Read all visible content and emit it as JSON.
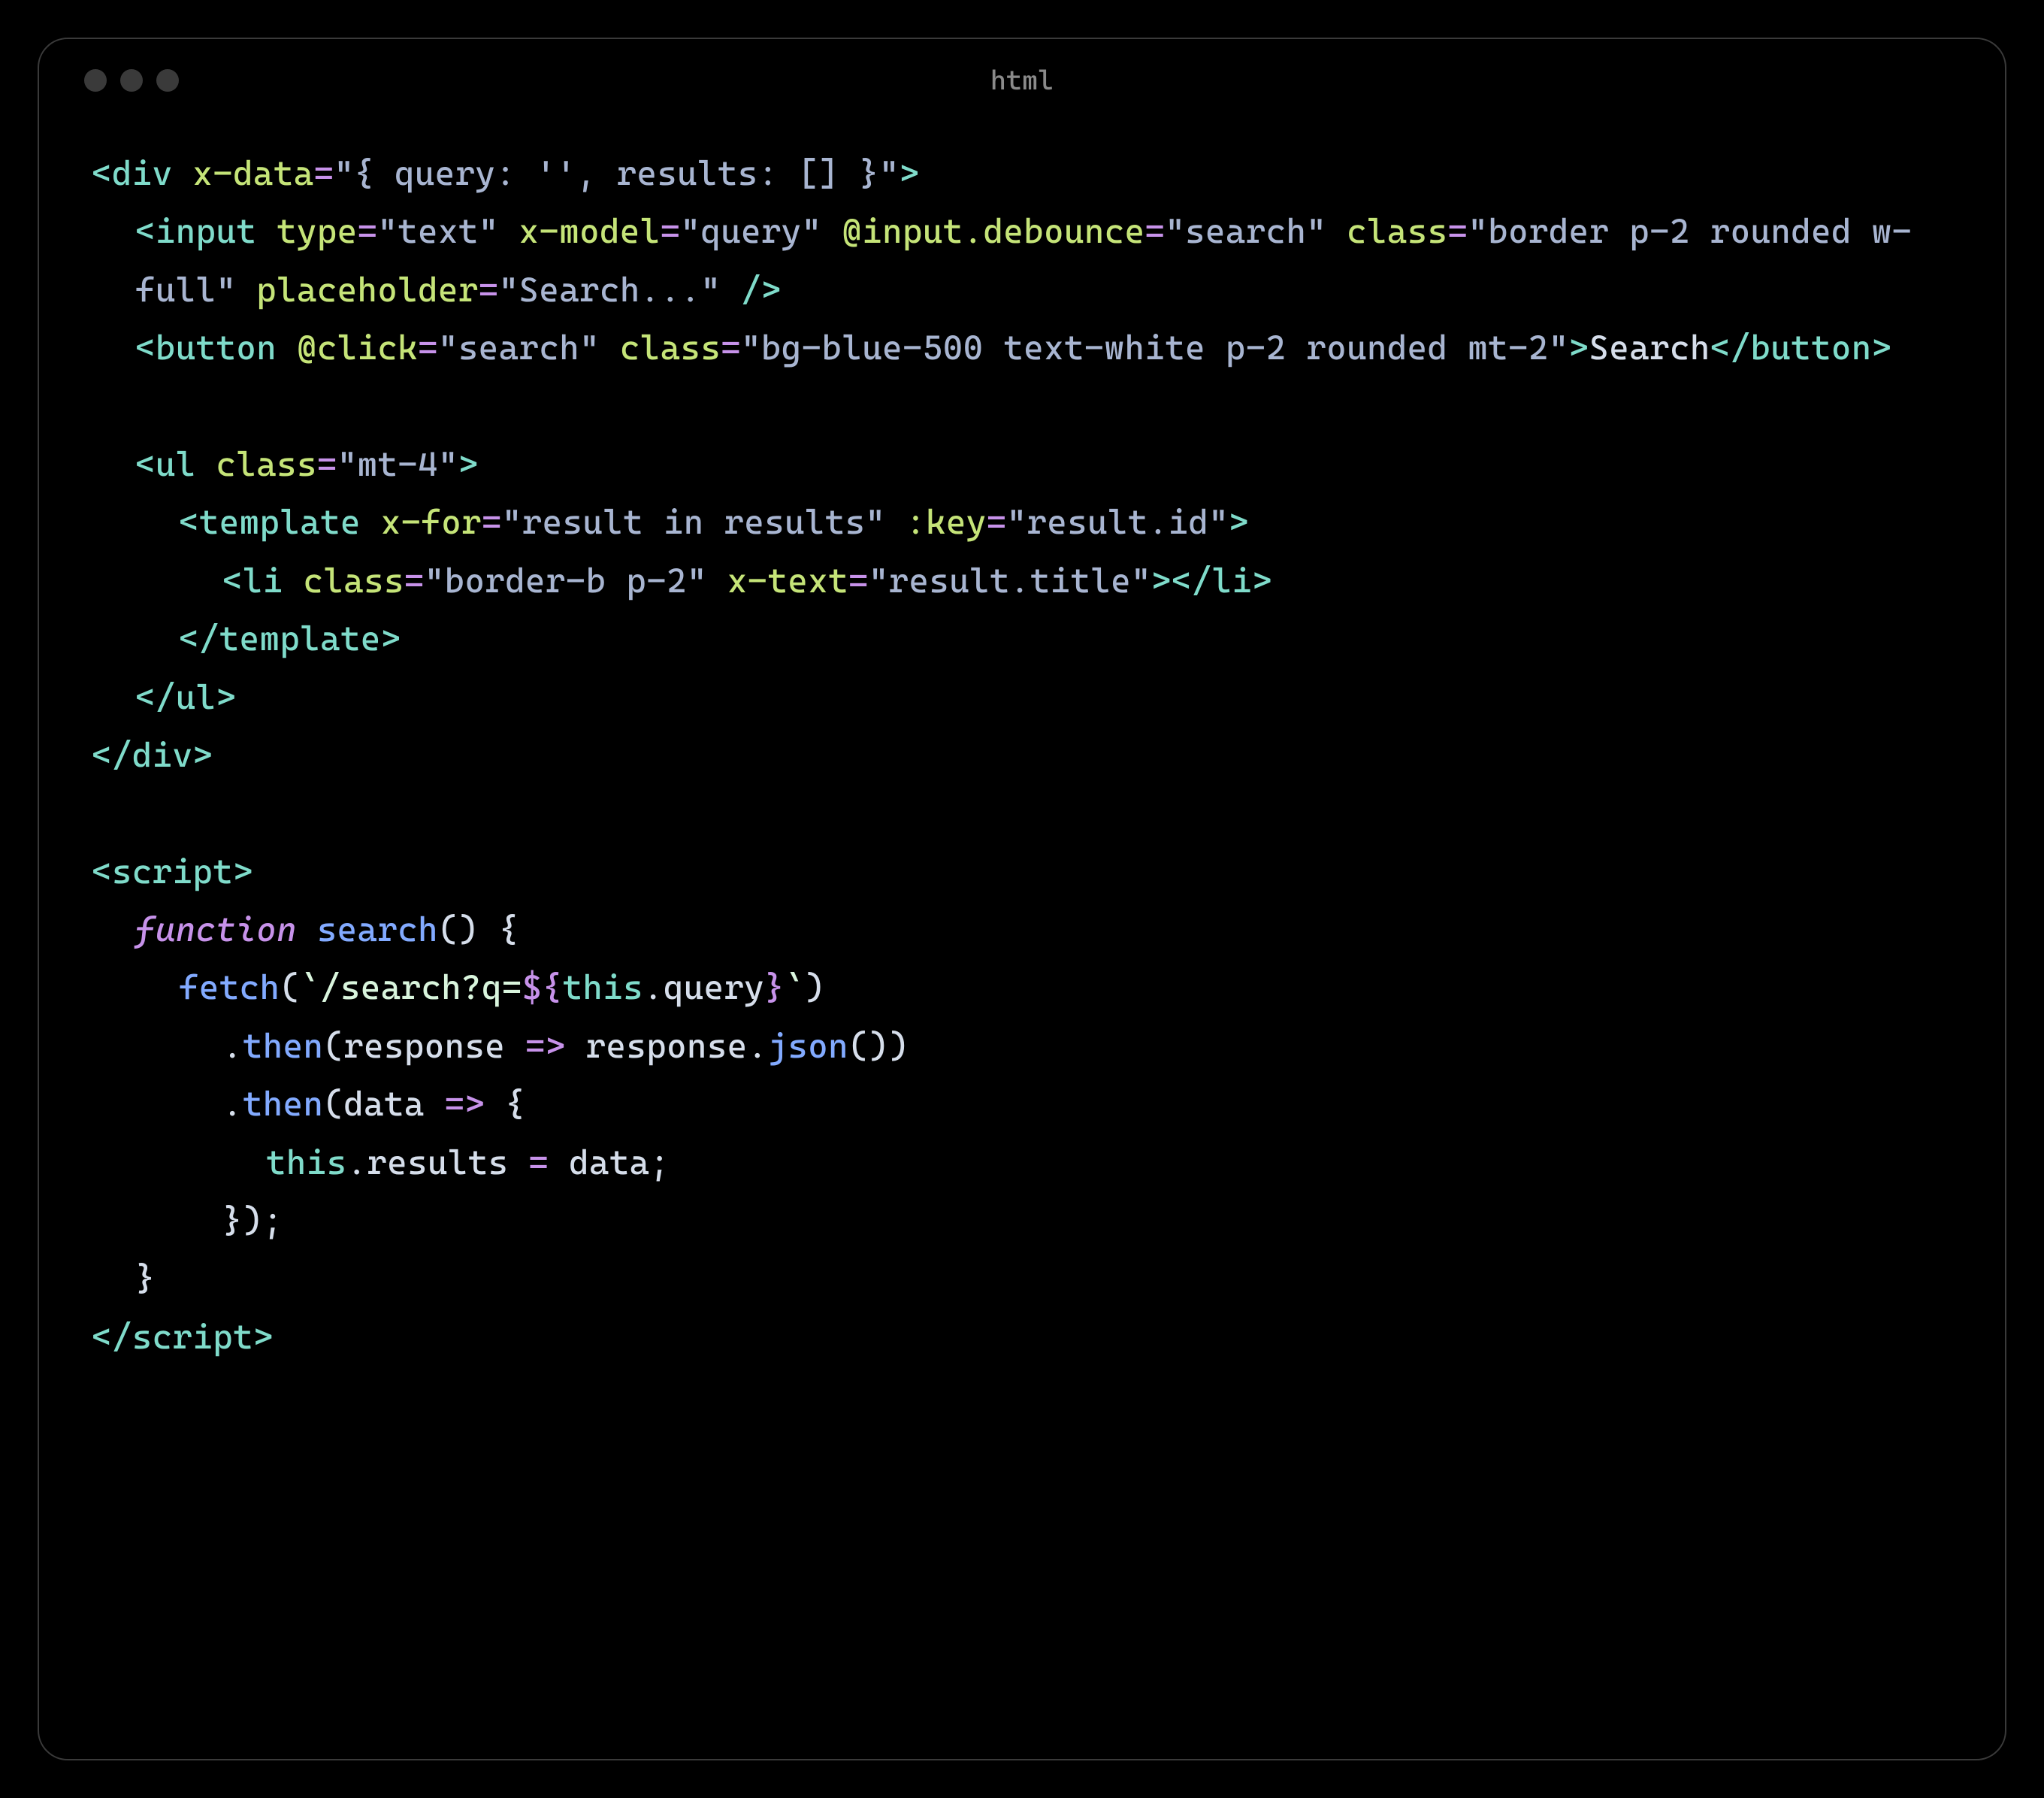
{
  "window": {
    "title": "html"
  },
  "code": {
    "lines": [
      {
        "indent": 0,
        "segs": [
          {
            "c": "punct",
            "t": "<"
          },
          {
            "c": "tag",
            "t": "div"
          },
          {
            "c": "txt",
            "t": " "
          },
          {
            "c": "attr",
            "t": "x-data"
          },
          {
            "c": "eq",
            "t": "="
          },
          {
            "c": "str",
            "t": "\"{ query: '', results: [] }\""
          },
          {
            "c": "punct",
            "t": ">"
          }
        ]
      },
      {
        "indent": 1,
        "segs": [
          {
            "c": "punct",
            "t": "<"
          },
          {
            "c": "tag",
            "t": "input"
          },
          {
            "c": "txt",
            "t": " "
          },
          {
            "c": "attr",
            "t": "type"
          },
          {
            "c": "eq",
            "t": "="
          },
          {
            "c": "str",
            "t": "\"text\""
          },
          {
            "c": "txt",
            "t": " "
          },
          {
            "c": "attr",
            "t": "x-model"
          },
          {
            "c": "eq",
            "t": "="
          },
          {
            "c": "str",
            "t": "\"query\""
          },
          {
            "c": "txt",
            "t": " "
          },
          {
            "c": "attr",
            "t": "@input.debounce"
          },
          {
            "c": "eq",
            "t": "="
          },
          {
            "c": "str",
            "t": "\"search\""
          },
          {
            "c": "txt",
            "t": " "
          },
          {
            "c": "attr",
            "t": "class"
          },
          {
            "c": "eq",
            "t": "="
          },
          {
            "c": "str",
            "t": "\"border p-2 rounded w-full\""
          },
          {
            "c": "txt",
            "t": " "
          },
          {
            "c": "attr",
            "t": "placeholder"
          },
          {
            "c": "eq",
            "t": "="
          },
          {
            "c": "str",
            "t": "\"Search...\""
          },
          {
            "c": "txt",
            "t": " "
          },
          {
            "c": "punct",
            "t": "/>"
          }
        ]
      },
      {
        "indent": 1,
        "segs": [
          {
            "c": "punct",
            "t": "<"
          },
          {
            "c": "tag",
            "t": "button"
          },
          {
            "c": "txt",
            "t": " "
          },
          {
            "c": "attr",
            "t": "@click"
          },
          {
            "c": "eq",
            "t": "="
          },
          {
            "c": "str",
            "t": "\"search\""
          },
          {
            "c": "txt",
            "t": " "
          },
          {
            "c": "attr",
            "t": "class"
          },
          {
            "c": "eq",
            "t": "="
          },
          {
            "c": "str",
            "t": "\"bg-blue-500 text-white p-2 rounded mt-2\""
          },
          {
            "c": "punct",
            "t": ">"
          },
          {
            "c": "txt",
            "t": "Search"
          },
          {
            "c": "punct",
            "t": "</"
          },
          {
            "c": "tag",
            "t": "button"
          },
          {
            "c": "punct",
            "t": ">"
          }
        ]
      },
      {
        "indent": 0,
        "segs": [
          {
            "c": "txt",
            "t": " "
          }
        ]
      },
      {
        "indent": 1,
        "segs": [
          {
            "c": "punct",
            "t": "<"
          },
          {
            "c": "tag",
            "t": "ul"
          },
          {
            "c": "txt",
            "t": " "
          },
          {
            "c": "attr",
            "t": "class"
          },
          {
            "c": "eq",
            "t": "="
          },
          {
            "c": "str",
            "t": "\"mt-4\""
          },
          {
            "c": "punct",
            "t": ">"
          }
        ]
      },
      {
        "indent": 2,
        "segs": [
          {
            "c": "punct",
            "t": "<"
          },
          {
            "c": "tag",
            "t": "template"
          },
          {
            "c": "txt",
            "t": " "
          },
          {
            "c": "attr",
            "t": "x-for"
          },
          {
            "c": "eq",
            "t": "="
          },
          {
            "c": "str",
            "t": "\"result in results\""
          },
          {
            "c": "txt",
            "t": " "
          },
          {
            "c": "attr",
            "t": ":key"
          },
          {
            "c": "eq",
            "t": "="
          },
          {
            "c": "str",
            "t": "\"result.id\""
          },
          {
            "c": "punct",
            "t": ">"
          }
        ]
      },
      {
        "indent": 3,
        "segs": [
          {
            "c": "punct",
            "t": "<"
          },
          {
            "c": "tag",
            "t": "li"
          },
          {
            "c": "txt",
            "t": " "
          },
          {
            "c": "attr",
            "t": "class"
          },
          {
            "c": "eq",
            "t": "="
          },
          {
            "c": "str",
            "t": "\"border-b p-2\""
          },
          {
            "c": "txt",
            "t": " "
          },
          {
            "c": "attr",
            "t": "x-text"
          },
          {
            "c": "eq",
            "t": "="
          },
          {
            "c": "str",
            "t": "\"result.title\""
          },
          {
            "c": "punct",
            "t": "></"
          },
          {
            "c": "tag",
            "t": "li"
          },
          {
            "c": "punct",
            "t": ">"
          }
        ]
      },
      {
        "indent": 2,
        "segs": [
          {
            "c": "punct",
            "t": "</"
          },
          {
            "c": "tag",
            "t": "template"
          },
          {
            "c": "punct",
            "t": ">"
          }
        ]
      },
      {
        "indent": 1,
        "segs": [
          {
            "c": "punct",
            "t": "</"
          },
          {
            "c": "tag",
            "t": "ul"
          },
          {
            "c": "punct",
            "t": ">"
          }
        ]
      },
      {
        "indent": 0,
        "segs": [
          {
            "c": "punct",
            "t": "</"
          },
          {
            "c": "tag",
            "t": "div"
          },
          {
            "c": "punct",
            "t": ">"
          }
        ]
      },
      {
        "indent": 0,
        "segs": [
          {
            "c": "txt",
            "t": " "
          }
        ]
      },
      {
        "indent": 0,
        "segs": [
          {
            "c": "punct",
            "t": "<"
          },
          {
            "c": "tag",
            "t": "script"
          },
          {
            "c": "punct",
            "t": ">"
          }
        ]
      },
      {
        "indent": 1,
        "segs": [
          {
            "c": "kw",
            "t": "function"
          },
          {
            "c": "txt",
            "t": " "
          },
          {
            "c": "fn",
            "t": "search"
          },
          {
            "c": "txt",
            "t": "() {"
          }
        ]
      },
      {
        "indent": 2,
        "segs": [
          {
            "c": "call",
            "t": "fetch"
          },
          {
            "c": "txt",
            "t": "("
          },
          {
            "c": "tpl",
            "t": "`/search?q="
          },
          {
            "c": "op",
            "t": "${"
          },
          {
            "c": "this",
            "t": "this"
          },
          {
            "c": "txt",
            "t": "."
          },
          {
            "c": "prop",
            "t": "query"
          },
          {
            "c": "op",
            "t": "}"
          },
          {
            "c": "tpl",
            "t": "`"
          },
          {
            "c": "txt",
            "t": ")"
          }
        ]
      },
      {
        "indent": 3,
        "segs": [
          {
            "c": "txt",
            "t": "."
          },
          {
            "c": "call",
            "t": "then"
          },
          {
            "c": "txt",
            "t": "("
          },
          {
            "c": "param",
            "t": "response"
          },
          {
            "c": "txt",
            "t": " "
          },
          {
            "c": "op",
            "t": "=>"
          },
          {
            "c": "txt",
            "t": " "
          },
          {
            "c": "param",
            "t": "response"
          },
          {
            "c": "txt",
            "t": "."
          },
          {
            "c": "call",
            "t": "json"
          },
          {
            "c": "txt",
            "t": "())"
          }
        ]
      },
      {
        "indent": 3,
        "segs": [
          {
            "c": "txt",
            "t": "."
          },
          {
            "c": "call",
            "t": "then"
          },
          {
            "c": "txt",
            "t": "("
          },
          {
            "c": "param",
            "t": "data"
          },
          {
            "c": "txt",
            "t": " "
          },
          {
            "c": "op",
            "t": "=>"
          },
          {
            "c": "txt",
            "t": " {"
          }
        ]
      },
      {
        "indent": 4,
        "segs": [
          {
            "c": "this",
            "t": "this"
          },
          {
            "c": "txt",
            "t": "."
          },
          {
            "c": "prop",
            "t": "results"
          },
          {
            "c": "txt",
            "t": " "
          },
          {
            "c": "op",
            "t": "="
          },
          {
            "c": "txt",
            "t": " "
          },
          {
            "c": "param",
            "t": "data"
          },
          {
            "c": "txt",
            "t": ";"
          }
        ]
      },
      {
        "indent": 3,
        "segs": [
          {
            "c": "txt",
            "t": "});"
          }
        ]
      },
      {
        "indent": 1,
        "segs": [
          {
            "c": "txt",
            "t": "}"
          }
        ]
      },
      {
        "indent": 0,
        "segs": [
          {
            "c": "punct",
            "t": "</"
          },
          {
            "c": "tag",
            "t": "script"
          },
          {
            "c": "punct",
            "t": ">"
          }
        ]
      }
    ]
  }
}
